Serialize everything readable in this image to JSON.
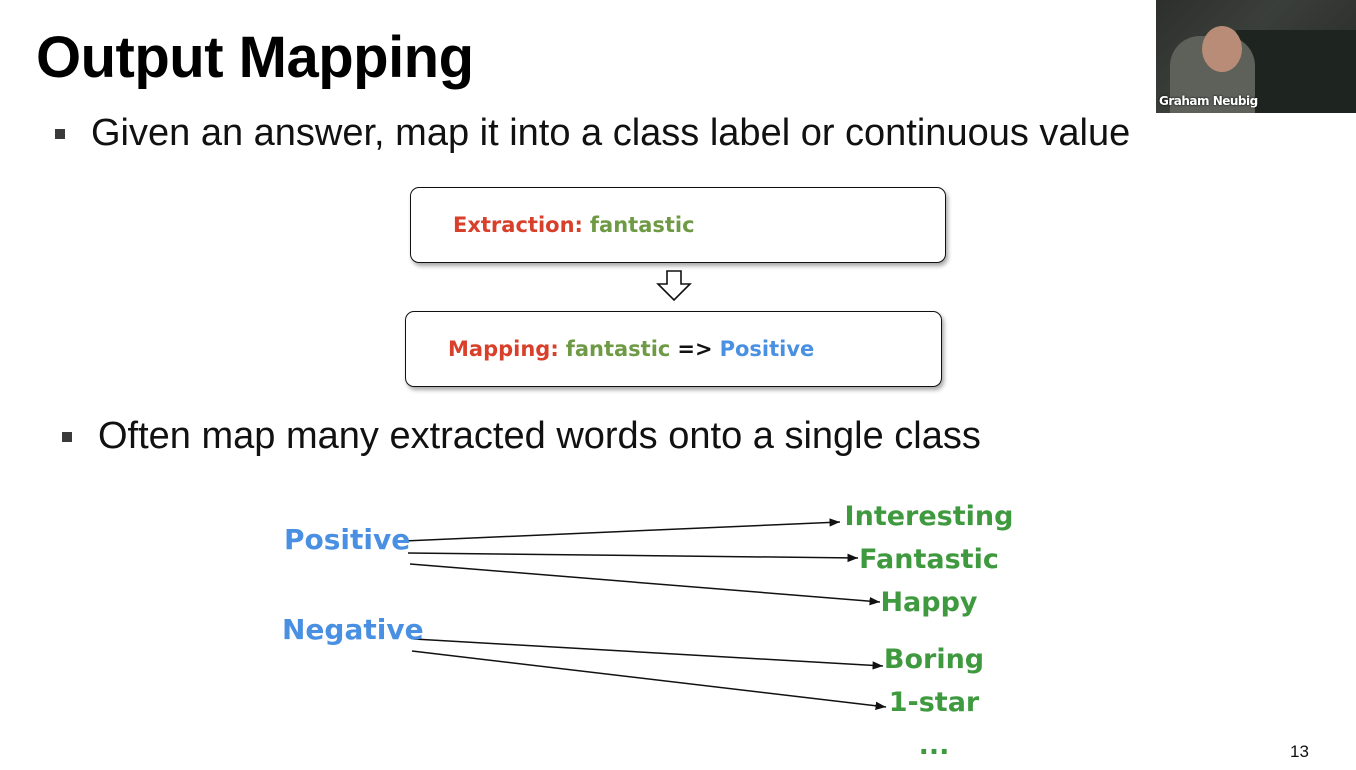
{
  "slide": {
    "title": "Output Mapping",
    "page_number": "13",
    "bullets": [
      "Given an answer, map it into a class label or continuous value",
      "Often map many extracted words onto a single class"
    ]
  },
  "extraction_box": {
    "label": "Extraction:",
    "value": "fantastic"
  },
  "mapping_box": {
    "label": "Mapping:",
    "source": "fantastic",
    "arrow": "=>",
    "target": "Positive"
  },
  "mapping_diagram": {
    "classes": [
      "Positive",
      "Negative"
    ],
    "words": [
      "Interesting",
      "Fantastic",
      "Happy",
      "Boring",
      "1-star",
      "..."
    ]
  },
  "video": {
    "participant_name": "Graham Neubig"
  },
  "colors": {
    "red": "#d9402b",
    "olive_green": "#6e9a45",
    "blue": "#4a90e2",
    "word_green": "#3f9a3f"
  }
}
